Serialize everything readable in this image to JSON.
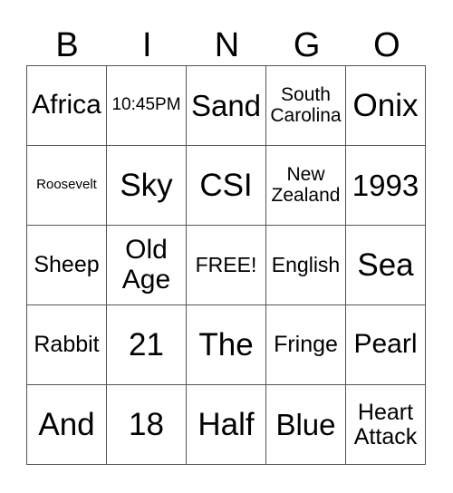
{
  "header": {
    "letters": [
      "B",
      "I",
      "N",
      "G",
      "O"
    ]
  },
  "rows": [
    [
      "Africa",
      "10:45PM",
      "Sand",
      "South Carolina",
      "Onix"
    ],
    [
      "Roosevelt",
      "Sky",
      "CSI",
      "New Zealand",
      "1993"
    ],
    [
      "Sheep",
      "Old Age",
      "FREE!",
      "English",
      "Sea"
    ],
    [
      "Rabbit",
      "21",
      "The",
      "Fringe",
      "Pearl"
    ],
    [
      "And",
      "18",
      "Half",
      "Blue",
      "Heart Attack"
    ]
  ],
  "free_space": {
    "row": 2,
    "col": 2,
    "label": "FREE!"
  }
}
